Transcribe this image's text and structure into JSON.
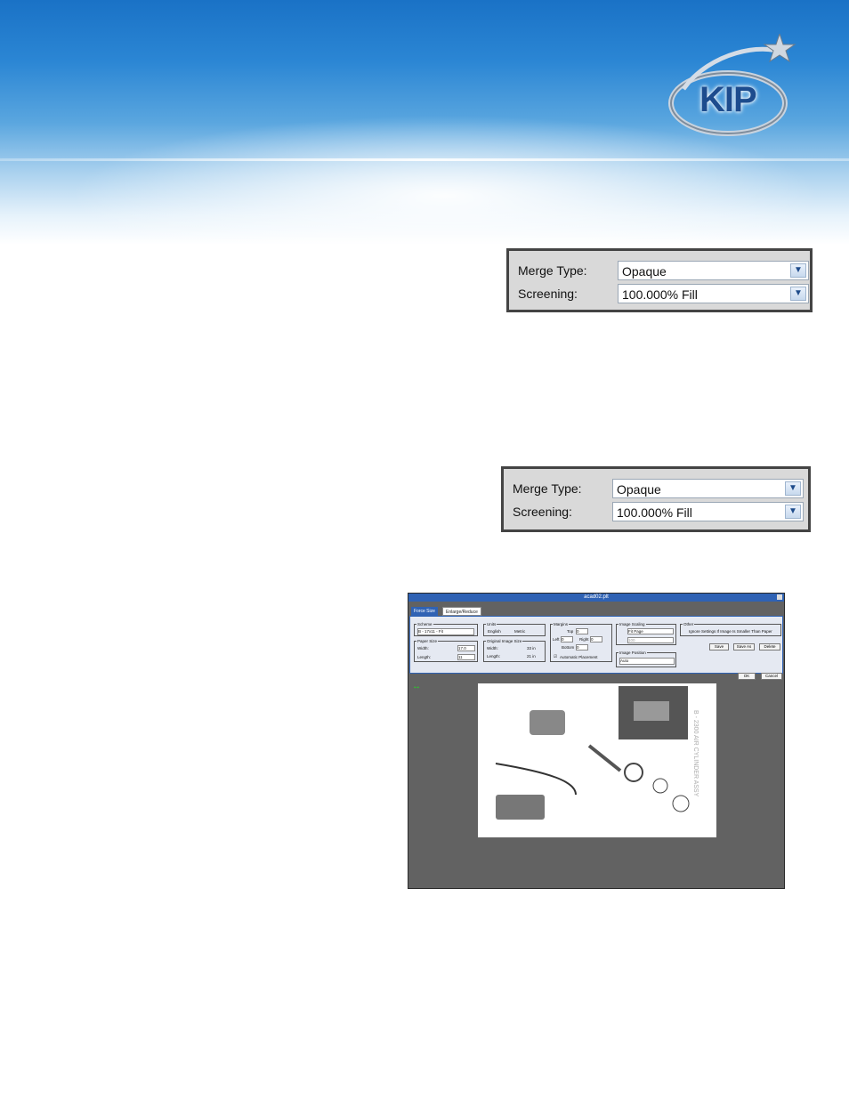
{
  "header": {
    "logo_text": "KIP"
  },
  "merge_panels": [
    {
      "merge_type_label": "Merge Type:",
      "merge_type_value": "Opaque",
      "screening_label": "Screening:",
      "screening_value": "100.000% Fill"
    },
    {
      "merge_type_label": "Merge Type:",
      "merge_type_value": "Opaque",
      "screening_label": "Screening:",
      "screening_value": "100.000% Fill"
    }
  ],
  "dialog": {
    "title": "acad02.plt",
    "tabs": [
      "Force Size",
      "Enlarge/Reduce"
    ],
    "scheme": {
      "label": "Scheme",
      "value": "B - 17x11 - Fit"
    },
    "units": {
      "label": "Units",
      "options": [
        "English",
        "Metric"
      ]
    },
    "margins": {
      "label": "Margins",
      "top_label": "Top",
      "top": "0",
      "left_label": "Left",
      "left": "0",
      "right_label": "Right",
      "right": "0",
      "bottom_label": "Bottom",
      "bottom": "0",
      "auto_label": "Automatic Placement"
    },
    "image_scaling": {
      "label": "Image Scaling",
      "value": "Fit Page",
      "percent": "100"
    },
    "image_position": {
      "label": "Image Position",
      "value": "Auto"
    },
    "other": {
      "label": "Other",
      "checkbox": "Ignore Settings If Image Is Smaller Than Paper"
    },
    "paper_size": {
      "label": "Paper Size",
      "width_label": "Width:",
      "width": "17.0",
      "length_label": "Length:",
      "length": "11"
    },
    "original_size": {
      "label": "Original Image Size",
      "width_label": "Width:",
      "width": "33 in",
      "length_label": "Length:",
      "length": "21 in"
    },
    "buttons": {
      "save": "Save",
      "save_as": "Save As",
      "delete": "Delete",
      "ok": "OK",
      "cancel": "Cancel"
    },
    "drawing_title": "B - 2300 AIR CYLINDER ASSY"
  }
}
